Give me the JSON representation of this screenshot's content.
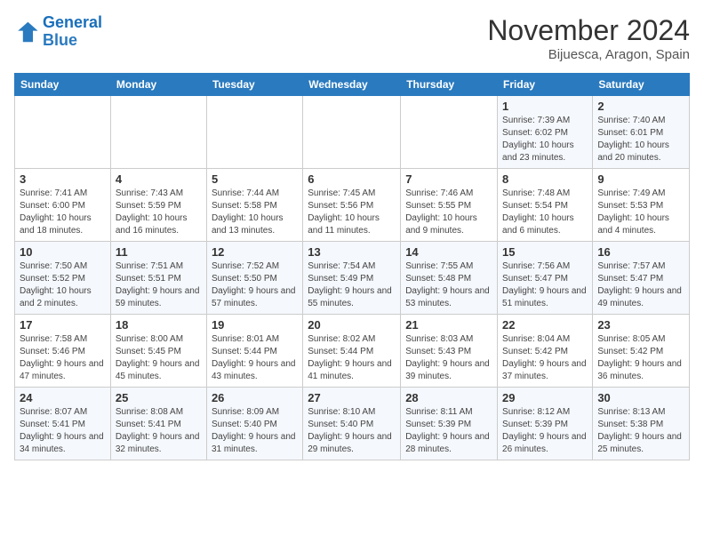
{
  "logo": {
    "line1": "General",
    "line2": "Blue"
  },
  "title": "November 2024",
  "location": "Bijuesca, Aragon, Spain",
  "days_of_week": [
    "Sunday",
    "Monday",
    "Tuesday",
    "Wednesday",
    "Thursday",
    "Friday",
    "Saturday"
  ],
  "weeks": [
    [
      {
        "day": "",
        "info": ""
      },
      {
        "day": "",
        "info": ""
      },
      {
        "day": "",
        "info": ""
      },
      {
        "day": "",
        "info": ""
      },
      {
        "day": "",
        "info": ""
      },
      {
        "day": "1",
        "info": "Sunrise: 7:39 AM\nSunset: 6:02 PM\nDaylight: 10 hours and 23 minutes."
      },
      {
        "day": "2",
        "info": "Sunrise: 7:40 AM\nSunset: 6:01 PM\nDaylight: 10 hours and 20 minutes."
      }
    ],
    [
      {
        "day": "3",
        "info": "Sunrise: 7:41 AM\nSunset: 6:00 PM\nDaylight: 10 hours and 18 minutes."
      },
      {
        "day": "4",
        "info": "Sunrise: 7:43 AM\nSunset: 5:59 PM\nDaylight: 10 hours and 16 minutes."
      },
      {
        "day": "5",
        "info": "Sunrise: 7:44 AM\nSunset: 5:58 PM\nDaylight: 10 hours and 13 minutes."
      },
      {
        "day": "6",
        "info": "Sunrise: 7:45 AM\nSunset: 5:56 PM\nDaylight: 10 hours and 11 minutes."
      },
      {
        "day": "7",
        "info": "Sunrise: 7:46 AM\nSunset: 5:55 PM\nDaylight: 10 hours and 9 minutes."
      },
      {
        "day": "8",
        "info": "Sunrise: 7:48 AM\nSunset: 5:54 PM\nDaylight: 10 hours and 6 minutes."
      },
      {
        "day": "9",
        "info": "Sunrise: 7:49 AM\nSunset: 5:53 PM\nDaylight: 10 hours and 4 minutes."
      }
    ],
    [
      {
        "day": "10",
        "info": "Sunrise: 7:50 AM\nSunset: 5:52 PM\nDaylight: 10 hours and 2 minutes."
      },
      {
        "day": "11",
        "info": "Sunrise: 7:51 AM\nSunset: 5:51 PM\nDaylight: 9 hours and 59 minutes."
      },
      {
        "day": "12",
        "info": "Sunrise: 7:52 AM\nSunset: 5:50 PM\nDaylight: 9 hours and 57 minutes."
      },
      {
        "day": "13",
        "info": "Sunrise: 7:54 AM\nSunset: 5:49 PM\nDaylight: 9 hours and 55 minutes."
      },
      {
        "day": "14",
        "info": "Sunrise: 7:55 AM\nSunset: 5:48 PM\nDaylight: 9 hours and 53 minutes."
      },
      {
        "day": "15",
        "info": "Sunrise: 7:56 AM\nSunset: 5:47 PM\nDaylight: 9 hours and 51 minutes."
      },
      {
        "day": "16",
        "info": "Sunrise: 7:57 AM\nSunset: 5:47 PM\nDaylight: 9 hours and 49 minutes."
      }
    ],
    [
      {
        "day": "17",
        "info": "Sunrise: 7:58 AM\nSunset: 5:46 PM\nDaylight: 9 hours and 47 minutes."
      },
      {
        "day": "18",
        "info": "Sunrise: 8:00 AM\nSunset: 5:45 PM\nDaylight: 9 hours and 45 minutes."
      },
      {
        "day": "19",
        "info": "Sunrise: 8:01 AM\nSunset: 5:44 PM\nDaylight: 9 hours and 43 minutes."
      },
      {
        "day": "20",
        "info": "Sunrise: 8:02 AM\nSunset: 5:44 PM\nDaylight: 9 hours and 41 minutes."
      },
      {
        "day": "21",
        "info": "Sunrise: 8:03 AM\nSunset: 5:43 PM\nDaylight: 9 hours and 39 minutes."
      },
      {
        "day": "22",
        "info": "Sunrise: 8:04 AM\nSunset: 5:42 PM\nDaylight: 9 hours and 37 minutes."
      },
      {
        "day": "23",
        "info": "Sunrise: 8:05 AM\nSunset: 5:42 PM\nDaylight: 9 hours and 36 minutes."
      }
    ],
    [
      {
        "day": "24",
        "info": "Sunrise: 8:07 AM\nSunset: 5:41 PM\nDaylight: 9 hours and 34 minutes."
      },
      {
        "day": "25",
        "info": "Sunrise: 8:08 AM\nSunset: 5:41 PM\nDaylight: 9 hours and 32 minutes."
      },
      {
        "day": "26",
        "info": "Sunrise: 8:09 AM\nSunset: 5:40 PM\nDaylight: 9 hours and 31 minutes."
      },
      {
        "day": "27",
        "info": "Sunrise: 8:10 AM\nSunset: 5:40 PM\nDaylight: 9 hours and 29 minutes."
      },
      {
        "day": "28",
        "info": "Sunrise: 8:11 AM\nSunset: 5:39 PM\nDaylight: 9 hours and 28 minutes."
      },
      {
        "day": "29",
        "info": "Sunrise: 8:12 AM\nSunset: 5:39 PM\nDaylight: 9 hours and 26 minutes."
      },
      {
        "day": "30",
        "info": "Sunrise: 8:13 AM\nSunset: 5:38 PM\nDaylight: 9 hours and 25 minutes."
      }
    ]
  ]
}
